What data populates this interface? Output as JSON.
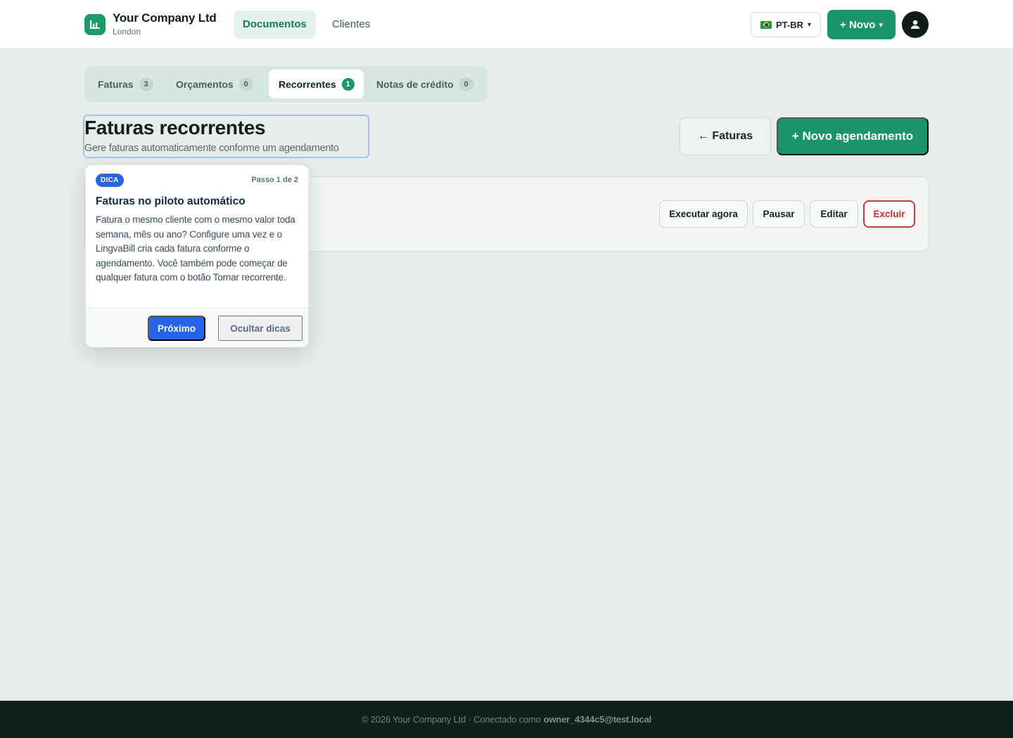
{
  "brand": {
    "company_name": "Your Company Ltd",
    "company_city": "London",
    "logo_icon": "bar-chart-icon",
    "accent_color": "#1a9468"
  },
  "nav": {
    "items": [
      {
        "label": "Documentos",
        "active": true
      },
      {
        "label": "Clientes",
        "active": false
      }
    ]
  },
  "header_actions": {
    "language": {
      "flag": "brazil-flag-icon",
      "label": "PT-BR",
      "caret": "▾"
    },
    "new_button": {
      "label": "+ Novo",
      "caret": "▾"
    },
    "avatar_icon": "user-icon"
  },
  "tabs": [
    {
      "label": "Faturas",
      "count": "3",
      "active": false
    },
    {
      "label": "Orçamentos",
      "count": "0",
      "active": false
    },
    {
      "label": "Recorrentes",
      "count": "1",
      "active": true
    },
    {
      "label": "Notas de crédito",
      "count": "0",
      "active": false
    }
  ],
  "page": {
    "title": "Faturas recorrentes",
    "subtitle": "Gere faturas automaticamente conforme um agendamento",
    "back_button": "← Faturas",
    "new_schedule_button": "+ Novo agendamento"
  },
  "schedule_actions": {
    "run_now": "Executar agora",
    "pause": "Pausar",
    "edit": "Editar",
    "delete": "Excluir"
  },
  "tip": {
    "badge": "DICA",
    "step": "Passo 1 de 2",
    "title": "Faturas no piloto automático",
    "body": "Fatura o mesmo cliente com o mesmo valor toda semana, mês ou ano? Configure uma vez e o LingvaBill cria cada fatura conforme o agendamento. Você também pode começar de qualquer fatura com o botão Tornar recorrente.",
    "next_button": "Próximo",
    "hide_button": "Ocultar dicas",
    "accent_color": "#2864e6"
  },
  "footer": {
    "prefix": "© 2026 Your Company Ltd · Conectado como",
    "user": "owner_4344c5@test.local"
  }
}
